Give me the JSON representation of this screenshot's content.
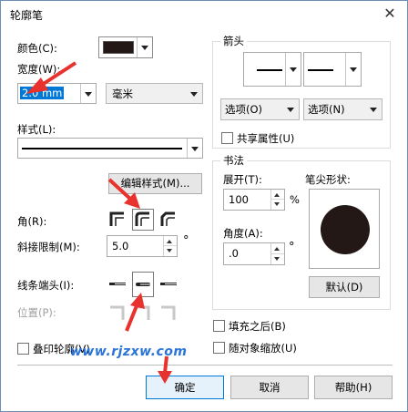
{
  "window": {
    "title": "轮廓笔",
    "close_label": "✕"
  },
  "left": {
    "color_label": "颜色(C):",
    "color_value": "#231815",
    "width_label": "宽度(W):",
    "width_value": "2.0 mm",
    "unit_value": "毫米",
    "style_label": "样式(L):",
    "edit_style_button": "编辑样式(M)...",
    "corner_label": "角(R):",
    "miter_label": "斜接限制(M):",
    "miter_value": "5.0",
    "degree_symbol": "°",
    "line_caps_label": "线条端头(I):",
    "position_label": "位置(P):",
    "overprint_label": "叠印轮廓(V)"
  },
  "arrows": {
    "group_title": "箭头",
    "options_left": "选项(O)",
    "options_right": "选项(N)",
    "share_label": "共享属性(U)"
  },
  "calligraphy": {
    "group_title": "书法",
    "stretch_label": "展开(T):",
    "stretch_value": "100",
    "percent_symbol": "%",
    "angle_label": "角度(A):",
    "angle_value": ".0",
    "degree_symbol": "°",
    "nib_label": "笔尖形状:",
    "default_button": "默认(D)"
  },
  "options": {
    "fill_behind_label": "填充之后(B)",
    "scale_with_object_label": "随对象缩放(U)"
  },
  "footer": {
    "ok_button": "确定",
    "cancel_button": "取消",
    "help_button": "帮助(H)"
  },
  "watermark_text": "www.rjzxw.com",
  "colors": {
    "accent": "#0078d7",
    "annotation_arrow": "#e8322d",
    "watermark": "#2a74d8"
  }
}
